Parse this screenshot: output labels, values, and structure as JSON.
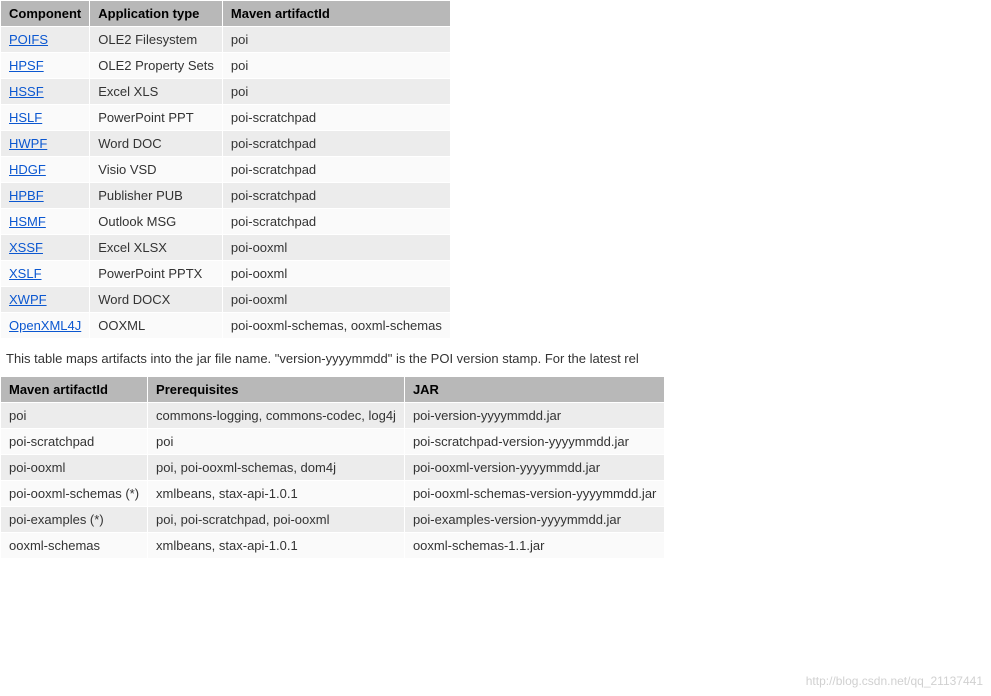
{
  "table1": {
    "headers": [
      "Component",
      "Application type",
      "Maven artifactId"
    ],
    "rows": [
      {
        "component": "POIFS",
        "link": true,
        "app": "OLE2 Filesystem",
        "artifact": "poi"
      },
      {
        "component": "HPSF",
        "link": true,
        "app": "OLE2 Property Sets",
        "artifact": "poi"
      },
      {
        "component": "HSSF",
        "link": true,
        "app": "Excel XLS",
        "artifact": "poi"
      },
      {
        "component": "HSLF",
        "link": true,
        "app": "PowerPoint PPT",
        "artifact": "poi-scratchpad"
      },
      {
        "component": "HWPF",
        "link": true,
        "app": "Word DOC",
        "artifact": "poi-scratchpad"
      },
      {
        "component": "HDGF",
        "link": true,
        "app": "Visio VSD",
        "artifact": "poi-scratchpad"
      },
      {
        "component": "HPBF",
        "link": true,
        "app": "Publisher PUB",
        "artifact": "poi-scratchpad"
      },
      {
        "component": "HSMF",
        "link": true,
        "app": "Outlook MSG",
        "artifact": "poi-scratchpad"
      },
      {
        "component": "XSSF",
        "link": true,
        "app": "Excel XLSX",
        "artifact": "poi-ooxml"
      },
      {
        "component": "XSLF",
        "link": true,
        "app": "PowerPoint PPTX",
        "artifact": "poi-ooxml"
      },
      {
        "component": "XWPF",
        "link": true,
        "app": "Word DOCX",
        "artifact": "poi-ooxml"
      },
      {
        "component": "OpenXML4J",
        "link": true,
        "app": "OOXML",
        "artifact": "poi-ooxml-schemas, ooxml-schemas"
      }
    ]
  },
  "paragraph": "This table maps artifacts into the jar file name. \"version-yyyymmdd\" is the POI version stamp. For the latest rel",
  "table2": {
    "headers": [
      "Maven artifactId",
      "Prerequisites",
      "JAR"
    ],
    "rows": [
      {
        "artifact": "poi",
        "prereq": "commons-logging, commons-codec, log4j",
        "jar": "poi-version-yyyymmdd.jar"
      },
      {
        "artifact": "poi-scratchpad",
        "prereq": "poi",
        "jar": "poi-scratchpad-version-yyyymmdd.jar"
      },
      {
        "artifact": "poi-ooxml",
        "prereq": "poi, poi-ooxml-schemas, dom4j",
        "jar": "poi-ooxml-version-yyyymmdd.jar"
      },
      {
        "artifact": "poi-ooxml-schemas (*)",
        "prereq": "xmlbeans, stax-api-1.0.1",
        "jar": "poi-ooxml-schemas-version-yyyymmdd.jar"
      },
      {
        "artifact": "poi-examples (*)",
        "prereq": "poi, poi-scratchpad, poi-ooxml",
        "jar": "poi-examples-version-yyyymmdd.jar"
      },
      {
        "artifact": "ooxml-schemas",
        "prereq": "xmlbeans, stax-api-1.0.1",
        "jar": "ooxml-schemas-1.1.jar"
      }
    ]
  },
  "watermark": "http://blog.csdn.net/qq_21137441"
}
